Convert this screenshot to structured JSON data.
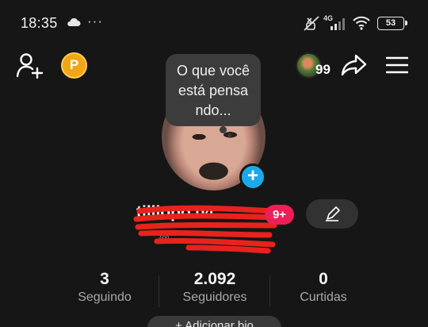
{
  "status_bar": {
    "time": "18:35",
    "more": "···",
    "network": "4G",
    "battery": "53",
    "icons": [
      "cloud-icon",
      "mute-icon",
      "signal-icon",
      "wifi-icon",
      "battery-icon"
    ]
  },
  "top_bar": {
    "points_label": "P",
    "visitor_count": "99",
    "icons": [
      "add-user-icon",
      "points-icon",
      "share-icon",
      "menu-icon"
    ]
  },
  "bubble": {
    "lines": [
      "O que você",
      "está pensa",
      "ndo..."
    ]
  },
  "profile": {
    "username": "tilllopo 04",
    "notification_badge": "9+",
    "handle": "@ ",
    "icons": [
      "add-story-icon",
      "edit-icon"
    ]
  },
  "stats": [
    {
      "value": "3",
      "label": "Seguindo"
    },
    {
      "value": "2.092",
      "label": "Seguidores"
    },
    {
      "value": "0",
      "label": "Curtidas"
    }
  ],
  "bottom_button": {
    "label": "+ Adicionar bio"
  },
  "colors": {
    "background": "#161616",
    "accent_blue": "#1da9e8",
    "badge_pink": "#f01d57",
    "points_gold": "#f2a516",
    "redaction_red": "#e8231d"
  }
}
